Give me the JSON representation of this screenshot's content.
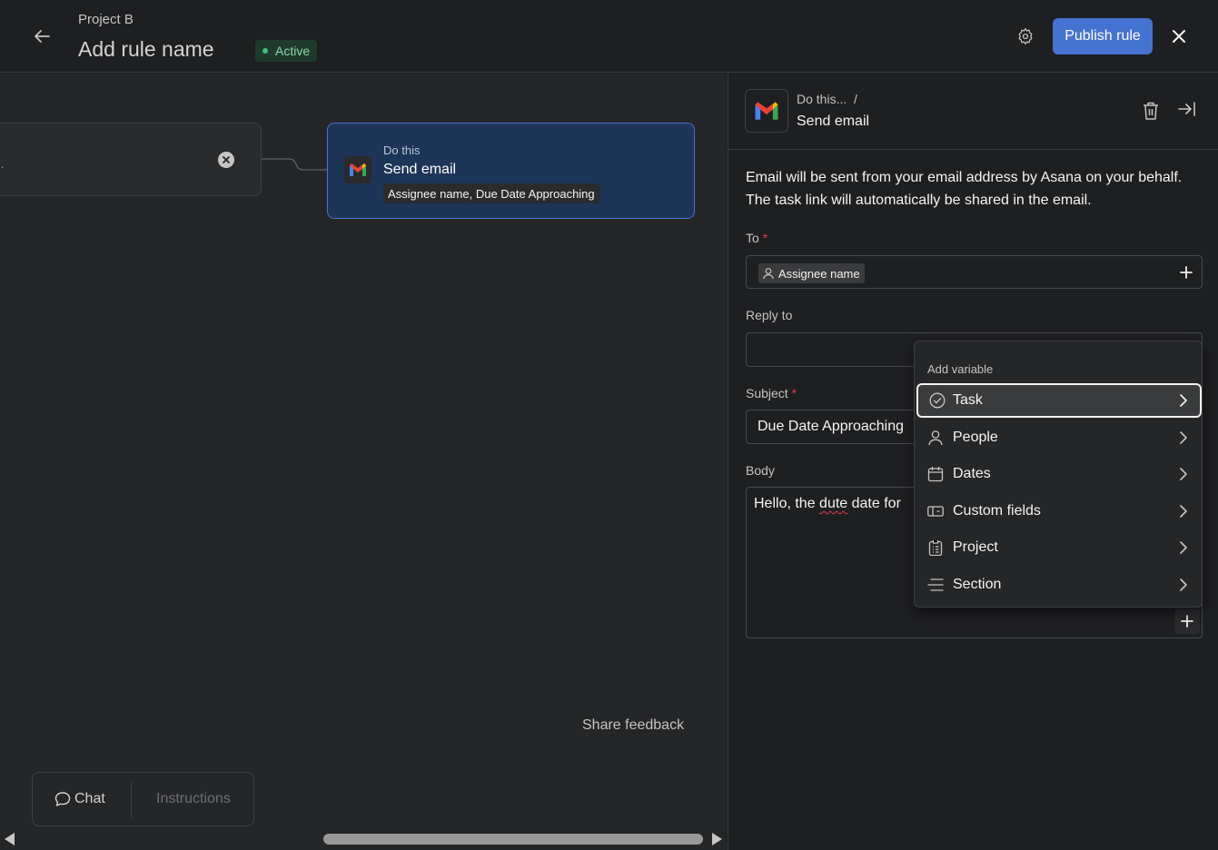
{
  "header": {
    "project_name": "Project B",
    "rule_name": "Add rule name",
    "status": "Active",
    "publish_label": "Publish rule"
  },
  "canvas": {
    "trigger": {
      "truncated_text": "."
    },
    "action": {
      "eyebrow": "Do this",
      "title": "Send email",
      "chip": "Assignee name, Due Date Approaching"
    },
    "bottom_bar": {
      "chat_label": "Chat",
      "instructions_label": "Instructions"
    },
    "share_feedback": "Share feedback"
  },
  "panel": {
    "breadcrumb": "Do this...  /",
    "title": "Send email",
    "description": "Email will be sent from your email address by Asana on your behalf. The task link will automatically be shared in the email.",
    "to_label": "To",
    "to_chip": "Assignee name",
    "reply_to_label": "Reply to",
    "reply_to_value": "",
    "subject_label": "Subject",
    "subject_value": "Due Date Approaching",
    "body_label": "Body",
    "body_prefix": "Hello, the ",
    "body_typo": "dute",
    "body_suffix": " date for",
    "required_mark": "*"
  },
  "menu": {
    "title": "Add variable",
    "items": [
      {
        "label": "Task",
        "icon": "check-circle-icon",
        "active": true
      },
      {
        "label": "People",
        "icon": "person-icon",
        "active": false
      },
      {
        "label": "Dates",
        "icon": "calendar-icon",
        "active": false
      },
      {
        "label": "Custom fields",
        "icon": "custom-fields-icon",
        "active": false
      },
      {
        "label": "Project",
        "icon": "clipboard-icon",
        "active": false
      },
      {
        "label": "Section",
        "icon": "section-lines-icon",
        "active": false
      }
    ]
  },
  "colors": {
    "accent": "#4573d2",
    "active_badge": "#8ad6a6",
    "required": "#e8384f",
    "action_card_bg": "#1d3557"
  }
}
